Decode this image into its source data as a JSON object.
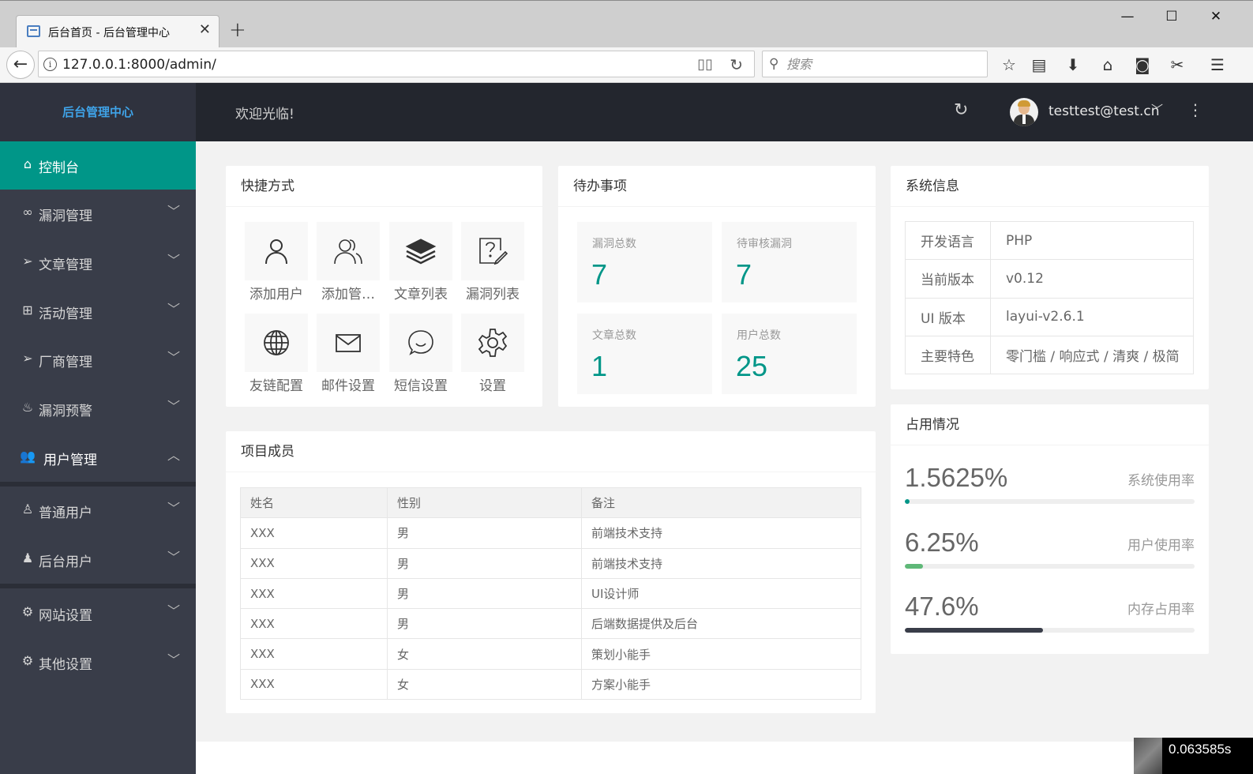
{
  "browser": {
    "tab_title": "后台首页 - 后台管理中心",
    "url": "127.0.0.1:8000/admin/",
    "search_placeholder": "搜索"
  },
  "sidebar": {
    "logo": "后台管理中心",
    "items": [
      {
        "label": "控制台",
        "icon": "home-icon"
      },
      {
        "label": "漏洞管理",
        "icon": "link-icon"
      },
      {
        "label": "文章管理",
        "icon": "send-icon"
      },
      {
        "label": "活动管理",
        "icon": "gift-icon"
      },
      {
        "label": "厂商管理",
        "icon": "send-icon"
      },
      {
        "label": "漏洞预警",
        "icon": "fire-icon"
      },
      {
        "label": "用户管理",
        "icon": "users-icon"
      },
      {
        "label": "普通用户",
        "icon": "user-outline-icon"
      },
      {
        "label": "后台用户",
        "icon": "user-icon"
      },
      {
        "label": "网站设置",
        "icon": "gear-icon"
      },
      {
        "label": "其他设置",
        "icon": "gear-icon"
      }
    ]
  },
  "header": {
    "welcome": "欢迎光临!",
    "user_email": "testtest@test.cn"
  },
  "shortcuts": {
    "title": "快捷方式",
    "items": [
      {
        "label": "添加用户",
        "icon": "user-icon"
      },
      {
        "label": "添加管…",
        "icon": "users-icon"
      },
      {
        "label": "文章列表",
        "icon": "layers-icon"
      },
      {
        "label": "漏洞列表",
        "icon": "help-doc-icon"
      },
      {
        "label": "友链配置",
        "icon": "globe-icon"
      },
      {
        "label": "邮件设置",
        "icon": "mail-icon"
      },
      {
        "label": "短信设置",
        "icon": "chat-icon"
      },
      {
        "label": "设置",
        "icon": "gear-icon"
      }
    ]
  },
  "todo": {
    "title": "待办事项",
    "items": [
      {
        "label": "漏洞总数",
        "value": "7"
      },
      {
        "label": "待审核漏洞",
        "value": "7"
      },
      {
        "label": "文章总数",
        "value": "1"
      },
      {
        "label": "用户总数",
        "value": "25"
      }
    ]
  },
  "sysinfo": {
    "title": "系统信息",
    "rows": [
      {
        "key": "开发语言",
        "value": "PHP"
      },
      {
        "key": "当前版本",
        "value": "v0.12"
      },
      {
        "key": "UI 版本",
        "value": "layui-v2.6.1"
      },
      {
        "key": "主要特色",
        "value": "零门槛 / 响应式 / 清爽 / 极简"
      }
    ]
  },
  "members": {
    "title": "项目成员",
    "headers": [
      "姓名",
      "性别",
      "备注"
    ],
    "rows": [
      [
        "XXX",
        "男",
        "前端技术支持"
      ],
      [
        "XXX",
        "男",
        "前端技术支持"
      ],
      [
        "XXX",
        "男",
        "UI设计师"
      ],
      [
        "XXX",
        "男",
        "后端数据提供及后台"
      ],
      [
        "XXX",
        "女",
        "策划小能手"
      ],
      [
        "XXX",
        "女",
        "方案小能手"
      ]
    ]
  },
  "usage": {
    "title": "占用情况",
    "items": [
      {
        "value": "1.5625%",
        "label": "系统使用率",
        "percent": 1.5625,
        "color": "#009688"
      },
      {
        "value": "6.25%",
        "label": "用户使用率",
        "percent": 6.25,
        "color": "#5fb878"
      },
      {
        "value": "47.6%",
        "label": "内存占用率",
        "percent": 47.6,
        "color": "#393d49"
      }
    ]
  },
  "timer": "0.063585s",
  "colors": {
    "accent": "#009688",
    "sidebar_bg": "#393d49",
    "header_bg": "#23262e"
  }
}
